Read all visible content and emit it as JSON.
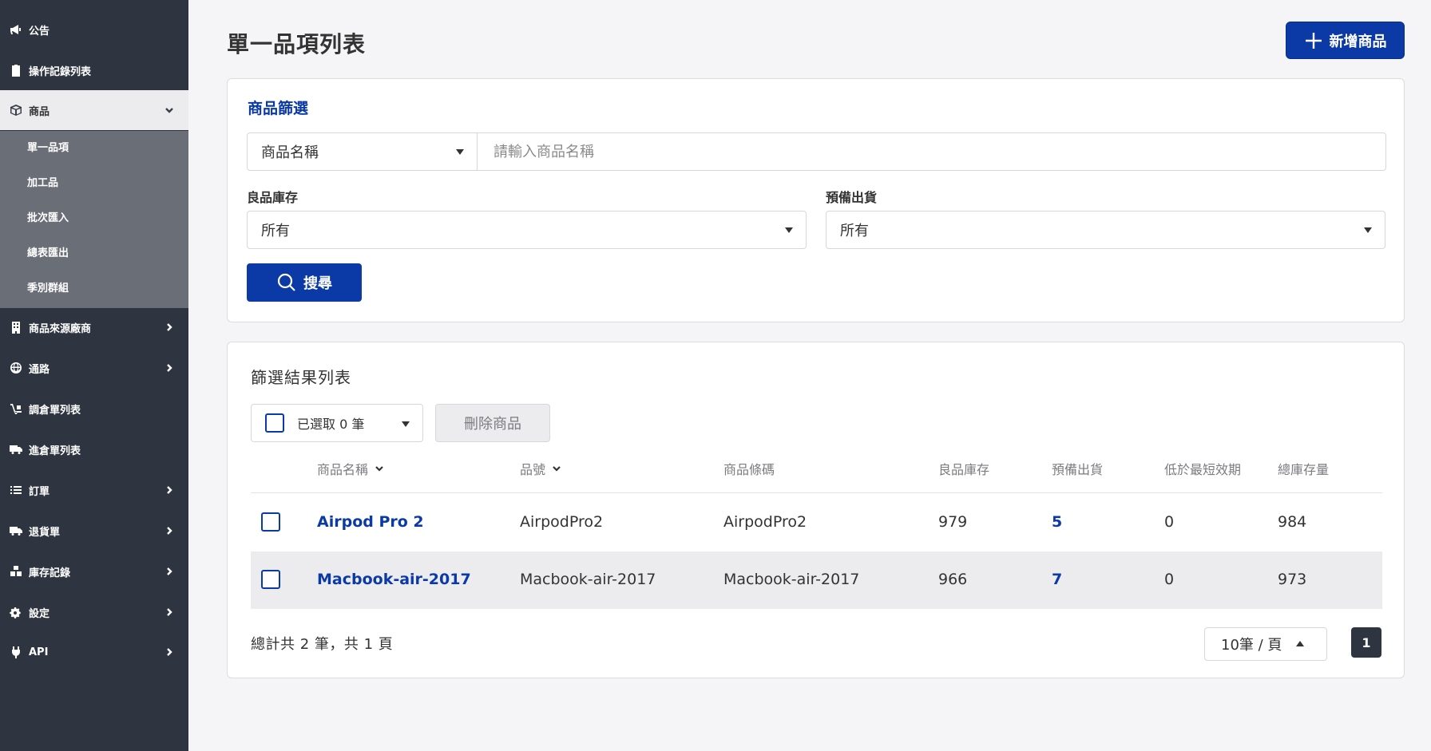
{
  "sidebar": {
    "items": [
      {
        "label": "公告"
      },
      {
        "label": "操作記錄列表"
      },
      {
        "label": "商品"
      },
      {
        "label": "商品來源廠商"
      },
      {
        "label": "通路"
      },
      {
        "label": "調倉單列表"
      },
      {
        "label": "進倉單列表"
      },
      {
        "label": "訂單"
      },
      {
        "label": "退貨單"
      },
      {
        "label": "庫存記錄"
      },
      {
        "label": "設定"
      },
      {
        "label": "API"
      }
    ],
    "sub_items": [
      {
        "label": "單一品項"
      },
      {
        "label": "加工品"
      },
      {
        "label": "批次匯入"
      },
      {
        "label": "總表匯出"
      },
      {
        "label": "季別群組"
      }
    ]
  },
  "header": {
    "title": "單一品項列表",
    "add_button": "新增商品"
  },
  "filter": {
    "title": "商品篩選",
    "field_select": "商品名稱",
    "name_placeholder": "請輸入商品名稱",
    "stock_label": "良品庫存",
    "stock_value": "所有",
    "ship_label": "預備出貨",
    "ship_value": "所有",
    "search_button": "搜尋"
  },
  "results": {
    "title": "篩選結果列表",
    "selected_text": "已選取 0 筆",
    "delete_button": "刪除商品",
    "columns": [
      "商品名稱",
      "品號",
      "商品條碼",
      "良品庫存",
      "預備出貨",
      "低於最短效期",
      "總庫存量"
    ],
    "rows": [
      {
        "name": "Airpod Pro 2",
        "sku": "AirpodPro2",
        "barcode": "AirpodPro2",
        "stock": "979",
        "ship": "5",
        "below": "0",
        "total": "984"
      },
      {
        "name": "Macbook-air-2017",
        "sku": "Macbook-air-2017",
        "barcode": "Macbook-air-2017",
        "stock": "966",
        "ship": "7",
        "below": "0",
        "total": "973"
      }
    ],
    "summary": "總計共 2 筆，共 1 頁",
    "page_size": "10筆 / 頁",
    "current_page": "1"
  }
}
